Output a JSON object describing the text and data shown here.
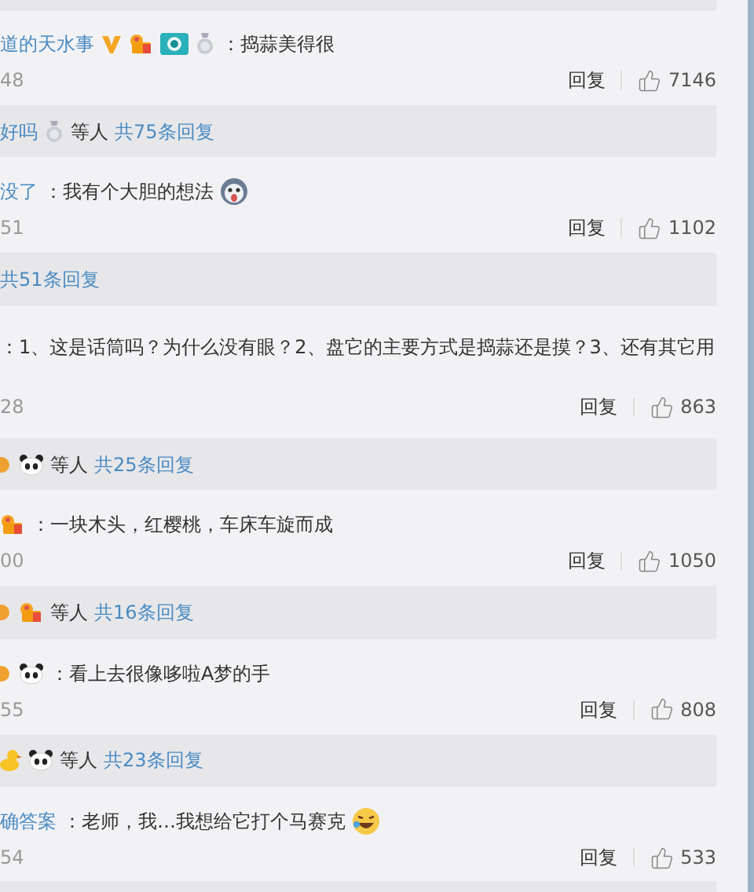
{
  "items": [
    {
      "kind": "summary"
    },
    {
      "kind": "comment",
      "author": "道的天水事",
      "badges": [
        {
          "kind": "verified"
        },
        {
          "kind": "fan"
        },
        {
          "kind": "camera"
        },
        {
          "kind": "medal"
        }
      ],
      "text": "：捣蒜美得很",
      "time": "48",
      "reply": "回复",
      "likes": "7146"
    },
    {
      "kind": "summary",
      "names": "好吗",
      "badges": [
        {
          "kind": "medal"
        }
      ],
      "others": "等人",
      "link": "共75条回复"
    },
    {
      "kind": "comment",
      "author": "没了",
      "text": "：我有个大胆的想法",
      "emoji": {
        "kind": "shock"
      },
      "time": "51",
      "reply": "回复",
      "likes": "1102"
    },
    {
      "kind": "summary",
      "link": "共51条回复"
    },
    {
      "kind": "comment",
      "text": "：1、这是话筒吗？为什么没有眼？2、盘它的主要方式是捣蒜还是摸？3、还有其它用",
      "time": "28",
      "reply": "回复",
      "likes": "863",
      "tall": true
    },
    {
      "kind": "summary",
      "badges": [
        {
          "kind": "round"
        },
        {
          "kind": "panda"
        }
      ],
      "others": "等人",
      "link": "共25条回复"
    },
    {
      "kind": "comment",
      "badges": [
        {
          "kind": "fan"
        }
      ],
      "text": "：一块木头，红樱桃，车床车旋而成",
      "time": "00",
      "reply": "回复",
      "likes": "1050"
    },
    {
      "kind": "summary",
      "badges": [
        {
          "kind": "round"
        },
        {
          "kind": "fan"
        }
      ],
      "others": "等人",
      "link": "共16条回复"
    },
    {
      "kind": "comment",
      "badges": [
        {
          "kind": "round"
        },
        {
          "kind": "panda"
        }
      ],
      "text": "：看上去很像哆啦A梦的手",
      "time": "55",
      "reply": "回复",
      "likes": "808"
    },
    {
      "kind": "summary",
      "badges": [
        {
          "kind": "duck"
        },
        {
          "kind": "panda"
        }
      ],
      "others": "等人",
      "link": "共23条回复"
    },
    {
      "kind": "comment",
      "author": "确答案",
      "text": "：老师，我…我想给它打个马赛克",
      "emoji": {
        "kind": "laugh"
      },
      "time": "54",
      "reply": "回复",
      "likes": "533"
    },
    {
      "kind": "summary"
    }
  ]
}
